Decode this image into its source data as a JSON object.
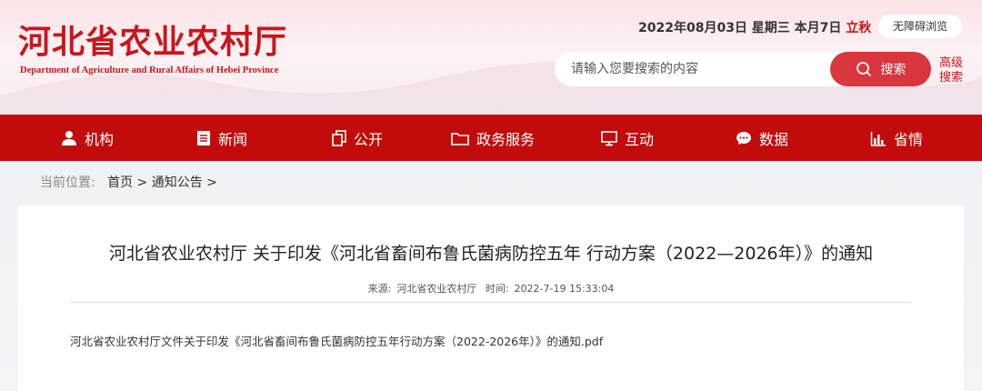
{
  "header": {
    "logo_cn": "河北省农业农村厅",
    "logo_en": "Department of Agriculture and Rural Affairs of Hebei Province",
    "date": "2022年08月03日 星期三 本月7日",
    "solar_term": "立秋",
    "accessibility_label": "无障碍浏览",
    "search_placeholder": "请输入您要搜索的内容",
    "search_button": "搜索",
    "advanced_search": "高级搜索"
  },
  "nav": {
    "items": [
      {
        "label": "机构",
        "icon": "person-icon"
      },
      {
        "label": "新闻",
        "icon": "news-icon"
      },
      {
        "label": "公开",
        "icon": "copy-icon"
      },
      {
        "label": "政务服务",
        "icon": "folder-icon"
      },
      {
        "label": "互动",
        "icon": "monitor-icon"
      },
      {
        "label": "数据",
        "icon": "chat-icon"
      },
      {
        "label": "省情",
        "icon": "bar-chart-icon"
      }
    ]
  },
  "breadcrumb": {
    "prefix": "当前位置:",
    "home": "首页",
    "sep1": ">",
    "section": "通知公告",
    "sep2": ">"
  },
  "article": {
    "title": "河北省农业农村厅 关于印发《河北省畜间布鲁氏菌病防控五年 行动方案（2022—2026年）》的通知",
    "source_label": "来源:",
    "source": "河北省农业农村厅",
    "time_label": "时间:",
    "time": "2022-7-19 15:33:04",
    "attachment": "河北省农业农村厅文件关于印发《河北省畜间布鲁氏菌病防控五年行动方案（2022-2026年）》的通知.pdf"
  },
  "colors": {
    "brand_red": "#c8161d",
    "nav_red": "#c20c0c",
    "search_red": "#d9363e"
  }
}
